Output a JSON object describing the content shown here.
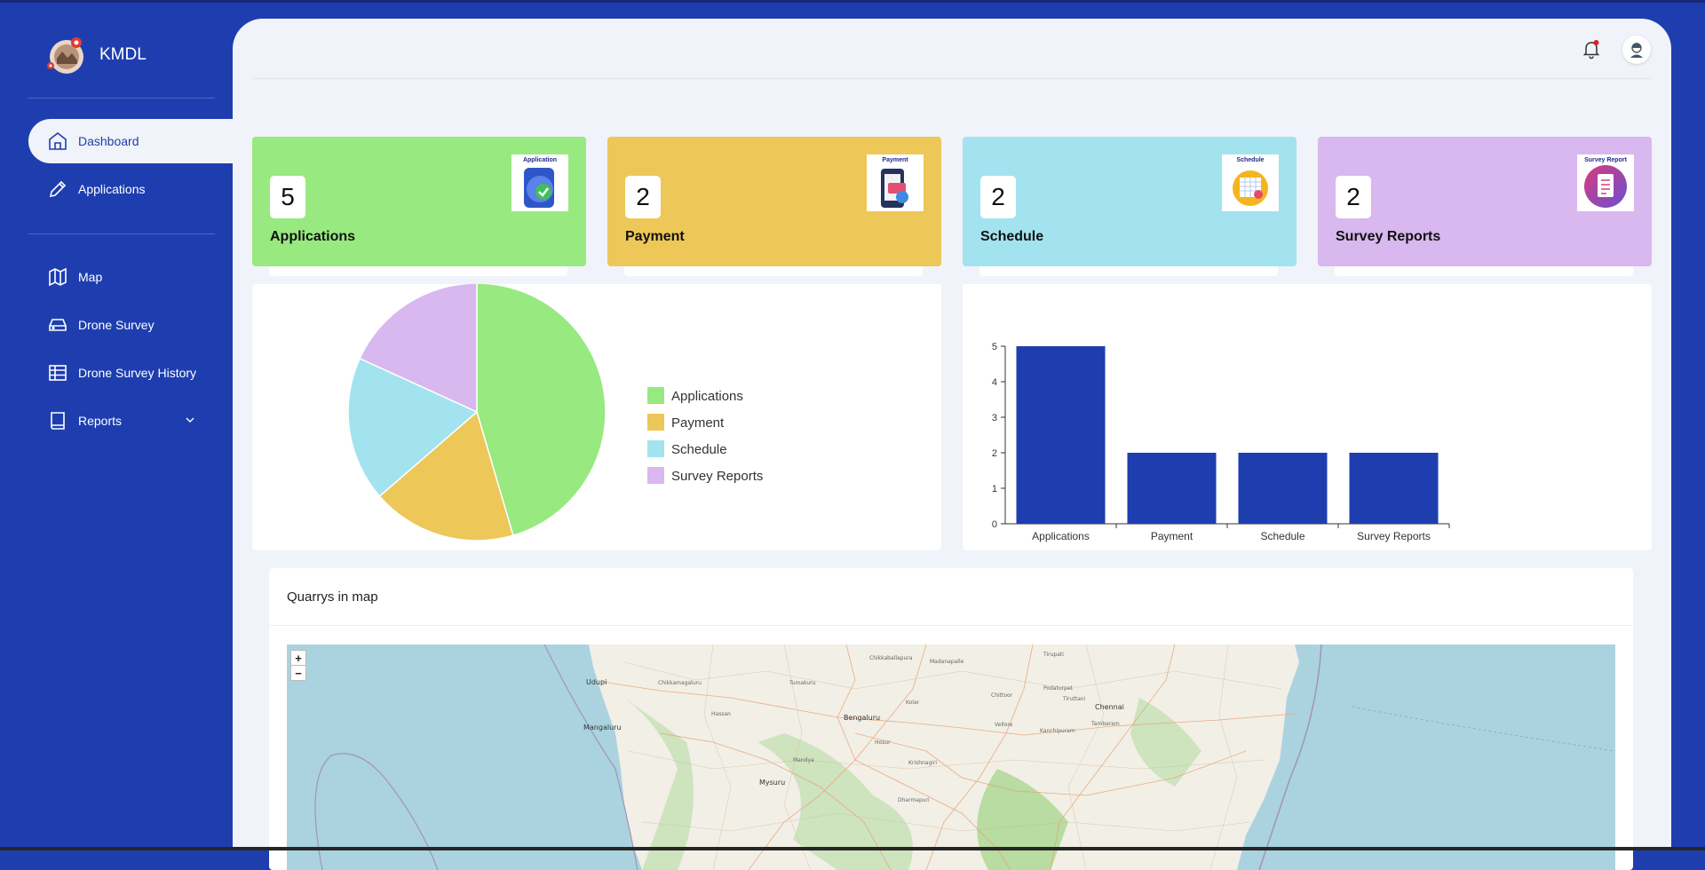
{
  "app": {
    "name": "KMDL"
  },
  "sidebar": {
    "items": [
      {
        "label": "Dashboard",
        "icon": "home-icon",
        "active": true
      },
      {
        "label": "Applications",
        "icon": "pencil-icon"
      },
      {
        "label": "Map",
        "icon": "map-icon"
      },
      {
        "label": "Drone Survey",
        "icon": "drive-icon"
      },
      {
        "label": "Drone Survey History",
        "icon": "table-icon"
      },
      {
        "label": "Reports",
        "icon": "book-icon",
        "expandable": true
      }
    ]
  },
  "header": {
    "notification_icon": "bell-icon",
    "has_unread": true,
    "avatar_icon": "user-avatar-icon"
  },
  "cards": [
    {
      "title": "Applications",
      "count": "5",
      "color": "#98e980",
      "image_label": "Application"
    },
    {
      "title": "Payment",
      "count": "2",
      "color": "#edc758",
      "image_label": "Payment"
    },
    {
      "title": "Schedule",
      "count": "2",
      "color": "#a2e3ef",
      "image_label": "Schedule"
    },
    {
      "title": "Survey Reports",
      "count": "2",
      "color": "#d8b8ef",
      "image_label": "Survey Report"
    }
  ],
  "chart_data": [
    {
      "type": "pie",
      "categories": [
        "Applications",
        "Payment",
        "Schedule",
        "Survey Reports"
      ],
      "values": [
        5,
        2,
        2,
        2
      ],
      "colors": [
        "#98e980",
        "#edc758",
        "#a2e3ef",
        "#d8b8ef"
      ],
      "legend": "right"
    },
    {
      "type": "bar",
      "categories": [
        "Applications",
        "Payment",
        "Schedule",
        "Survey Reports"
      ],
      "values": [
        5,
        2,
        2,
        2
      ],
      "ylim": [
        0,
        5
      ],
      "yticks": [
        "0",
        "1",
        "2",
        "3",
        "4",
        "5"
      ],
      "bar_color": "#1e3eb0"
    }
  ],
  "map": {
    "title": "Quarrys in map",
    "zoom_in": "+",
    "zoom_out": "−",
    "places": [
      "Udupi",
      "Chikkamagaluru",
      "Tumakuru",
      "Chikkaballapura",
      "Madanapalle",
      "Tirupati",
      "Hassan",
      "Kolar",
      "Chittoor",
      "Podaturpet",
      "Tiruttani",
      "Chennai",
      "Mangaluru",
      "Bengaluru",
      "Vellore",
      "Kanchipuram",
      "Tambaram",
      "Mandya",
      "Hosur",
      "Mysuru",
      "Dharmapuri",
      "Krishnagiri"
    ]
  }
}
